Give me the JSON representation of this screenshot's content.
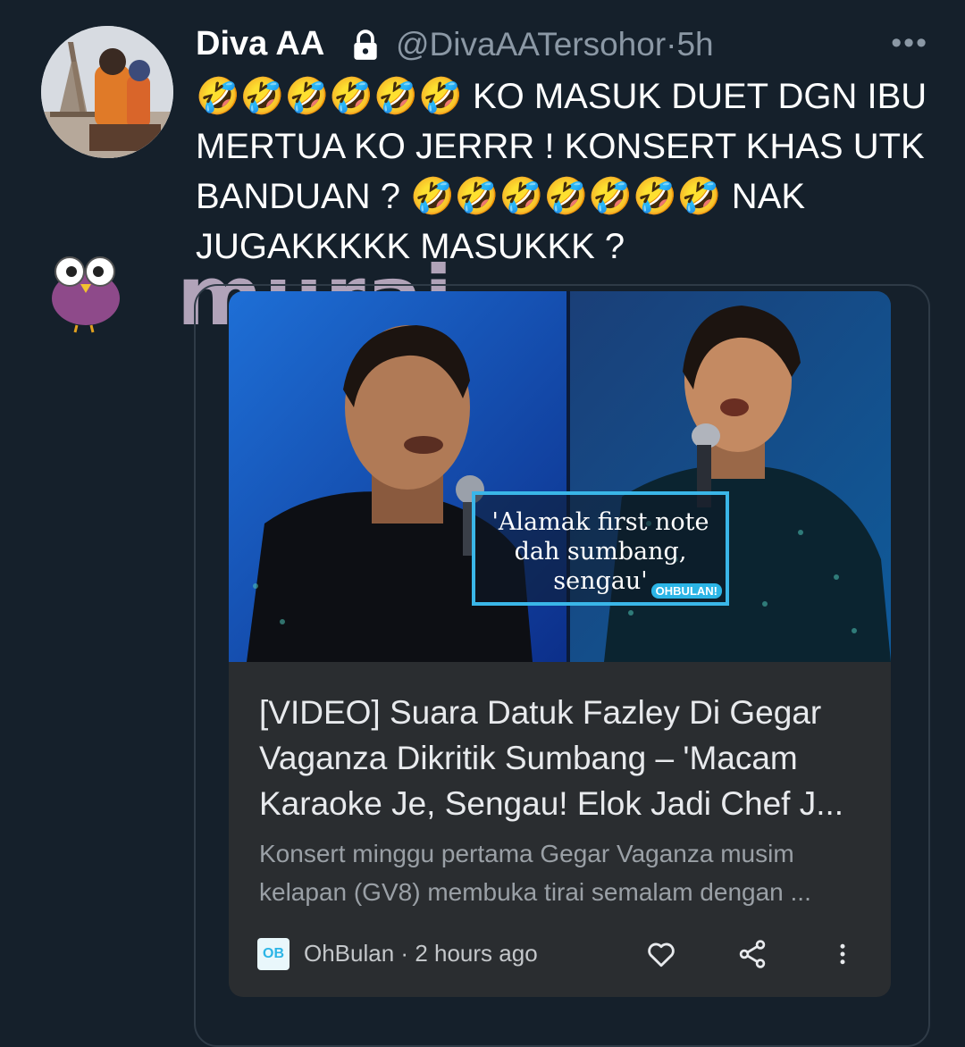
{
  "tweet": {
    "display_name": "Diva AA",
    "handle": "@DivaAATersohor",
    "separator": "·",
    "time": "5h",
    "more_label": "•••",
    "text": "🤣🤣🤣🤣🤣🤣 KO MASUK DUET DGN IBU MERTUA KO JERRR ! KONSERT KHAS UTK BANDUAN ? 🤣🤣🤣🤣🤣🤣🤣 NAK JUGAKKKKK MASUKKK ?"
  },
  "watermark": {
    "text": "murai"
  },
  "card": {
    "quote_text": "'Alamak first note dah sumbang, sengau'",
    "quote_logo": "OHBULAN!",
    "headline": "[VIDEO] Suara Datuk Fazley Di Gegar Vaganza Dikritik Sumbang – 'Macam Karaoke Je, Sengau! Elok Jadi Chef J...",
    "summary": "Konsert minggu pertama Gegar Vaganza musim kelapan (GV8) membuka tirai semalam dengan ...",
    "source_logo": "OB",
    "source": "OhBulan",
    "source_separator": "·",
    "age": "2 hours ago"
  },
  "colors": {
    "background": "#15202b",
    "card": "#2a2d30",
    "secondary_text": "#8b98a5",
    "accent": "#3ab6e8"
  },
  "icons": {
    "lock": "lock-icon",
    "more": "more-icon",
    "like": "heart-icon",
    "share": "share-icon",
    "overflow": "kebab-icon"
  }
}
